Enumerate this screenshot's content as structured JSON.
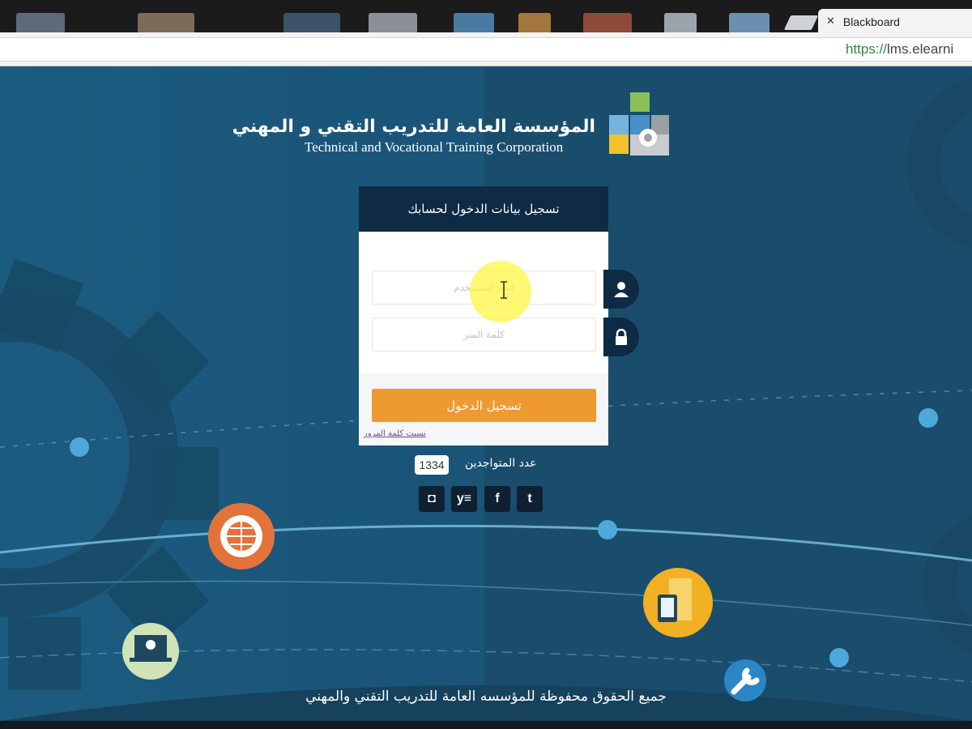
{
  "browser": {
    "active_tab_title": "Blackboard",
    "url_scheme": "https://",
    "url_rest": "lms.elearni"
  },
  "logo": {
    "arabic_name": "المؤسسة العامة للتدريب التقني و المهني",
    "english_name": "Technical and Vocational Training Corporation"
  },
  "login": {
    "title": "تسجيل بيانات الدخول لحسابك",
    "username_placeholder": "اسم المستخدم",
    "password_placeholder": "كلمة السر",
    "submit_label": "تسجيل الدخول",
    "forgot_password": "نسيت كلمة المرور"
  },
  "online": {
    "label": "عدد المتواجدين",
    "count": "1334"
  },
  "social": [
    {
      "name": "instagram-icon",
      "glyph": "◘"
    },
    {
      "name": "yammer-icon",
      "glyph": "y≡"
    },
    {
      "name": "facebook-icon",
      "glyph": "f"
    },
    {
      "name": "twitter-icon",
      "glyph": "t"
    }
  ],
  "footer": {
    "copyright": "جميع الحقوق محفوظة للمؤسسه العامة للتدريب التقني والمهني"
  },
  "colors": {
    "navy": "#0e2a44",
    "accent_orange": "#ef9a30",
    "background_blue": "#1c5a7e"
  }
}
